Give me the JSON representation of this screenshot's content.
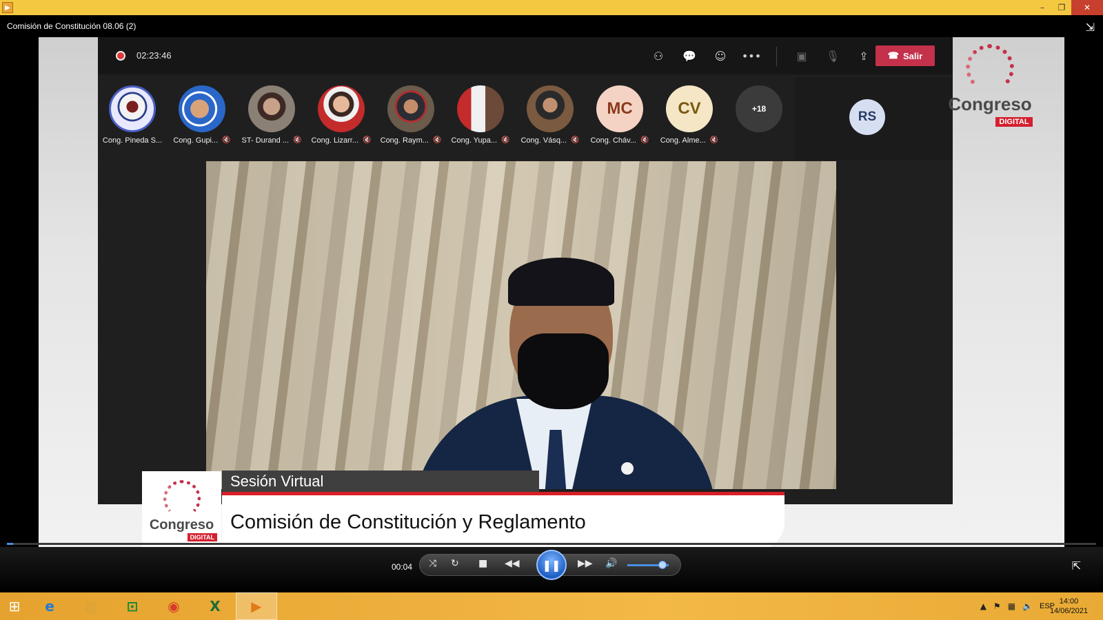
{
  "window": {
    "title": "Comisión de Constitución 08.06 (2)",
    "controls": {
      "minimize": "–",
      "restore": "❐",
      "close": "✕"
    }
  },
  "meeting": {
    "recording_time": "02:23:46",
    "toolbar_icons": [
      "participants-icon",
      "chat-icon",
      "reactions-icon",
      "more-icon",
      "camera-off-icon",
      "mic-off-icon",
      "share-icon"
    ],
    "leave_label": "Salir",
    "participants": [
      {
        "name": "Cong. Pineda S...",
        "muted": false
      },
      {
        "name": "Cong. Gupi...",
        "muted": true
      },
      {
        "name": "ST- Durand ...",
        "muted": true
      },
      {
        "name": "Cong. Lizarr...",
        "muted": true
      },
      {
        "name": "Cong. Raym...",
        "muted": true
      },
      {
        "name": "Cong. Yupa...",
        "muted": true
      },
      {
        "name": "Cong. Vásq...",
        "muted": true
      },
      {
        "name": "Cong. Cháv...",
        "initials": "MC",
        "muted": true
      },
      {
        "name": "Cong. Alme...",
        "initials": "CV",
        "muted": true
      }
    ],
    "more_count": "+18",
    "self_initials": "RS"
  },
  "branding": {
    "logo_word": "Congreso",
    "logo_badge": "DIGITAL"
  },
  "lower_third": {
    "tag": "Sesión Virtual",
    "title": "Comisión de Constitución y Reglamento"
  },
  "player": {
    "elapsed": "00:04",
    "progress": 0.006,
    "volume": 0.75
  },
  "taskbar": {
    "language": "ESP",
    "time": "14:00",
    "date": "14/06/2021"
  }
}
